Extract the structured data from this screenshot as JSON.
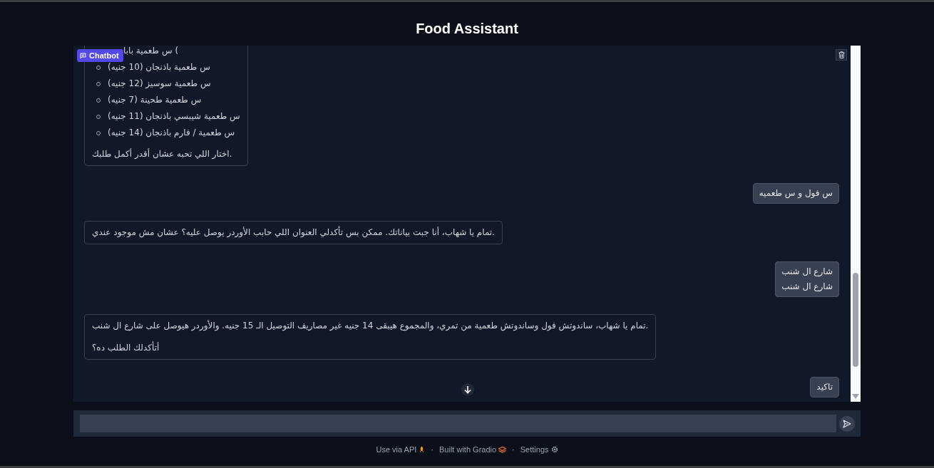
{
  "app": {
    "title": "Food Assistant"
  },
  "chatbot": {
    "label": "Chatbot",
    "messages": [
      {
        "kind": "bot",
        "blocks": [
          {
            "kind": "list",
            "items": [
              {
                "text": "س طعمية بابا (",
                "covered": true
              },
              {
                "text": "س طعمية باذنجان (10 جنيه)",
                "covered": false
              },
              {
                "text": "س طعمية سوسيز (12 جنيه)",
                "covered": false
              },
              {
                "text": "س طعمية طحينة (7 جنيه)",
                "covered": false
              },
              {
                "text": "س طعمية شيبسي باذنجان (11 جنيه)",
                "covered": false
              },
              {
                "text": "س طعمية / فارم باذنجان (14 جنيه)",
                "covered": false
              }
            ]
          },
          {
            "kind": "paragraph",
            "text": "اختار اللي تحبه عشان أقدر أكمل طلبك."
          }
        ]
      },
      {
        "kind": "user",
        "lines": [
          "س فول و س طعميه"
        ]
      },
      {
        "kind": "bot",
        "blocks": [
          {
            "kind": "paragraph",
            "text": "تمام يا شهاب، أنا جبت بياناتك. ممكن بس تأكدلي العنوان اللي حابب الأوردر يوصل عليه؟ عشان مش موجود عندي."
          }
        ]
      },
      {
        "kind": "user",
        "lines": [
          "شارع ال شنب",
          "شارع ال شنب"
        ]
      },
      {
        "kind": "bot",
        "blocks": [
          {
            "kind": "paragraph",
            "text": "تمام يا شهاب، ساندوتش فول وساندوتش طعمية من تمري، والمجموع هيبقى 14 جنيه غير مصاريف التوصيل الـ 15 جنيه. والأوردر هيوصل على شارع ال شنب."
          },
          {
            "kind": "paragraph",
            "text": "أتأكدلك الطلب ده؟"
          }
        ]
      },
      {
        "kind": "user",
        "lines": [
          "تاكيد"
        ]
      }
    ]
  },
  "footer": {
    "api_link": {
      "label": "Use via API"
    },
    "gradio_link": {
      "separator": "·",
      "label": "Built with Gradio"
    },
    "settings_link": {
      "separator": "·",
      "label": "Settings"
    }
  }
}
